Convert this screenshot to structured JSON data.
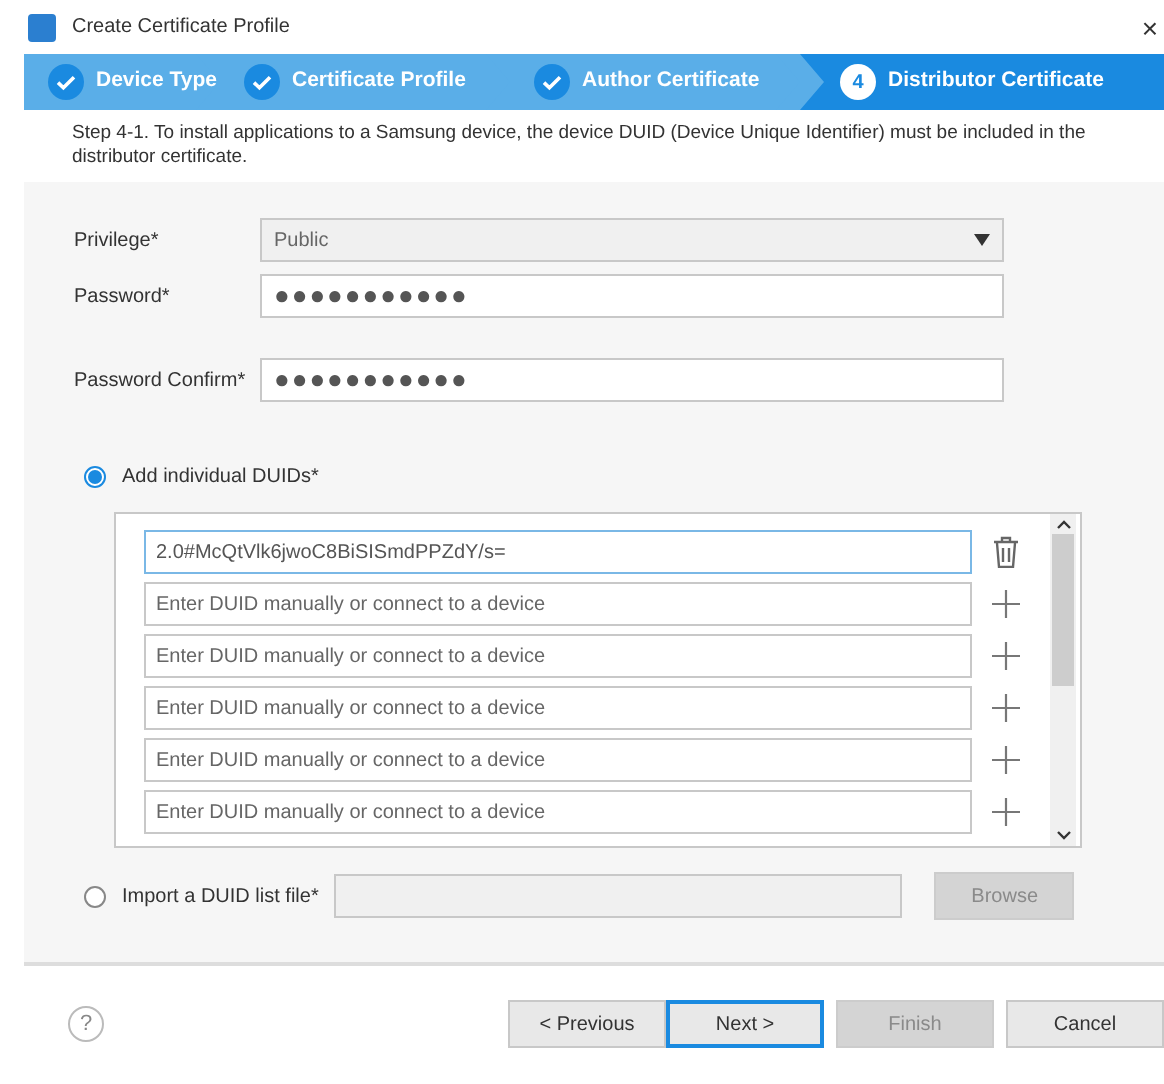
{
  "window": {
    "title": "Create Certificate Profile",
    "close": "×"
  },
  "steps": [
    {
      "label": "Device Type",
      "done": true,
      "selected": false
    },
    {
      "label": "Certificate Profile",
      "done": true,
      "selected": false
    },
    {
      "label": "Author Certificate",
      "done": true,
      "selected": false
    },
    {
      "label": "Distributor Certificate",
      "done": false,
      "number": "4",
      "selected": true
    }
  ],
  "description": "Step 4-1. To install applications to a Samsung device, the device DUID (Device Unique Identifier) must be included in the distributor certificate.",
  "fields": [
    {
      "label": "Privilege*",
      "kind": "select",
      "value": "Public"
    },
    {
      "label": "Password*",
      "kind": "password",
      "value": "●●●●●●●●●●●"
    },
    {
      "label": "Password Confirm*",
      "kind": "password",
      "value": "●●●●●●●●●●●"
    }
  ],
  "duid_option": {
    "label": "Add individual DUIDs*",
    "selected": true
  },
  "duids": [
    {
      "kind": "filled",
      "value": "2.0#McQtVlk6jwoC8BiSISmdPPZdY/s=",
      "focused": true
    },
    {
      "kind": "empty",
      "placeholder": "Enter DUID manually or connect to a device"
    },
    {
      "kind": "empty",
      "placeholder": "Enter DUID manually or connect to a device"
    },
    {
      "kind": "empty",
      "placeholder": "Enter DUID manually or connect to a device"
    },
    {
      "kind": "empty",
      "placeholder": "Enter DUID manually or connect to a device"
    },
    {
      "kind": "empty",
      "placeholder": "Enter DUID manually or connect to a device"
    }
  ],
  "import_option": {
    "label": "Import a DUID list file*",
    "selected": false
  },
  "browse": {
    "label": "Browse",
    "disabled": true
  },
  "buttons": [
    {
      "label": "< Previous",
      "disabled": false,
      "focused": false
    },
    {
      "label": "Next >",
      "disabled": false,
      "focused": true
    },
    {
      "label": "Finish",
      "disabled": true,
      "focused": false
    },
    {
      "label": "Cancel",
      "disabled": false,
      "focused": false
    }
  ],
  "help": "?"
}
